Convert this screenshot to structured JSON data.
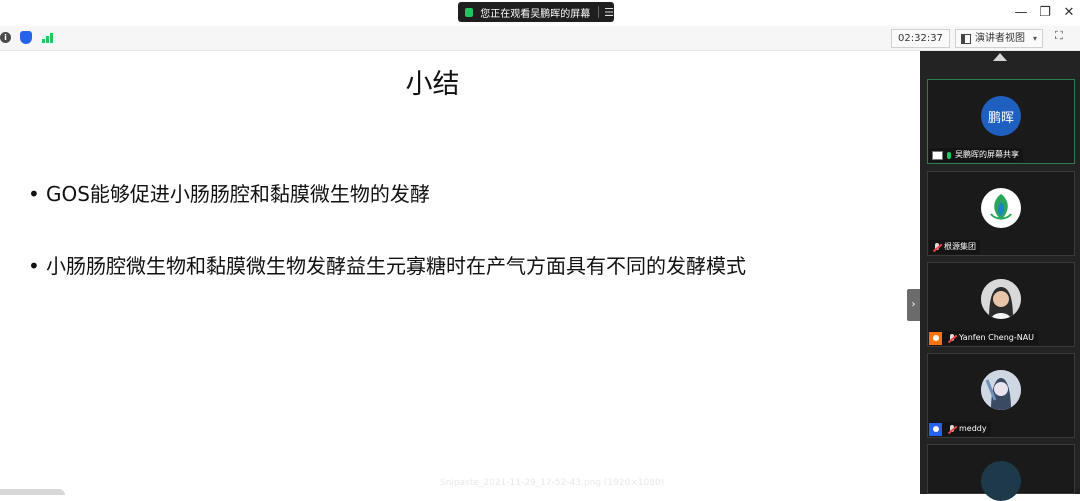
{
  "titlebar": {
    "share_status": "您正在观看吴鹏晖的屏幕",
    "menu_glyph": "☰",
    "minimize_glyph": "—",
    "restore_glyph": "❐",
    "close_glyph": "✕"
  },
  "toolbar": {
    "info_glyph": "i",
    "timer": "02:32:37",
    "view_label": "演讲者视图",
    "view_caret": "▾",
    "fullscreen_glyph": "⛶"
  },
  "slide": {
    "title": "小结",
    "bullets": [
      "GOS能够促进小肠肠腔和黏膜微生物的发酵",
      "小肠肠腔微生物和黏膜微生物发酵益生元寡糖时在产气方面具有不同的发酵模式"
    ],
    "bullet_glyph": "•",
    "watermark": "Snipaste_2021-11-29_17-52-43.png (1920×1080)"
  },
  "panel": {
    "collapse_glyph": "›",
    "participants": [
      {
        "avatar_text": "鹏晖",
        "name": "吴鹏晖的屏幕共享",
        "avatar_color": "#1f5fbf",
        "active": true,
        "sharing": true
      },
      {
        "avatar_text": "",
        "name": "根源集团",
        "avatar_color": "#ffffff",
        "active": false,
        "sharing": false
      },
      {
        "avatar_text": "",
        "name": "Yanfen Cheng-NAU",
        "avatar_color": "#c9a48a",
        "active": false,
        "sharing": false,
        "badge_color": "#f97316"
      },
      {
        "avatar_text": "",
        "name": "meddy",
        "avatar_color": "#9fb4c9",
        "active": false,
        "sharing": false,
        "badge_color": "#2563eb"
      }
    ]
  }
}
